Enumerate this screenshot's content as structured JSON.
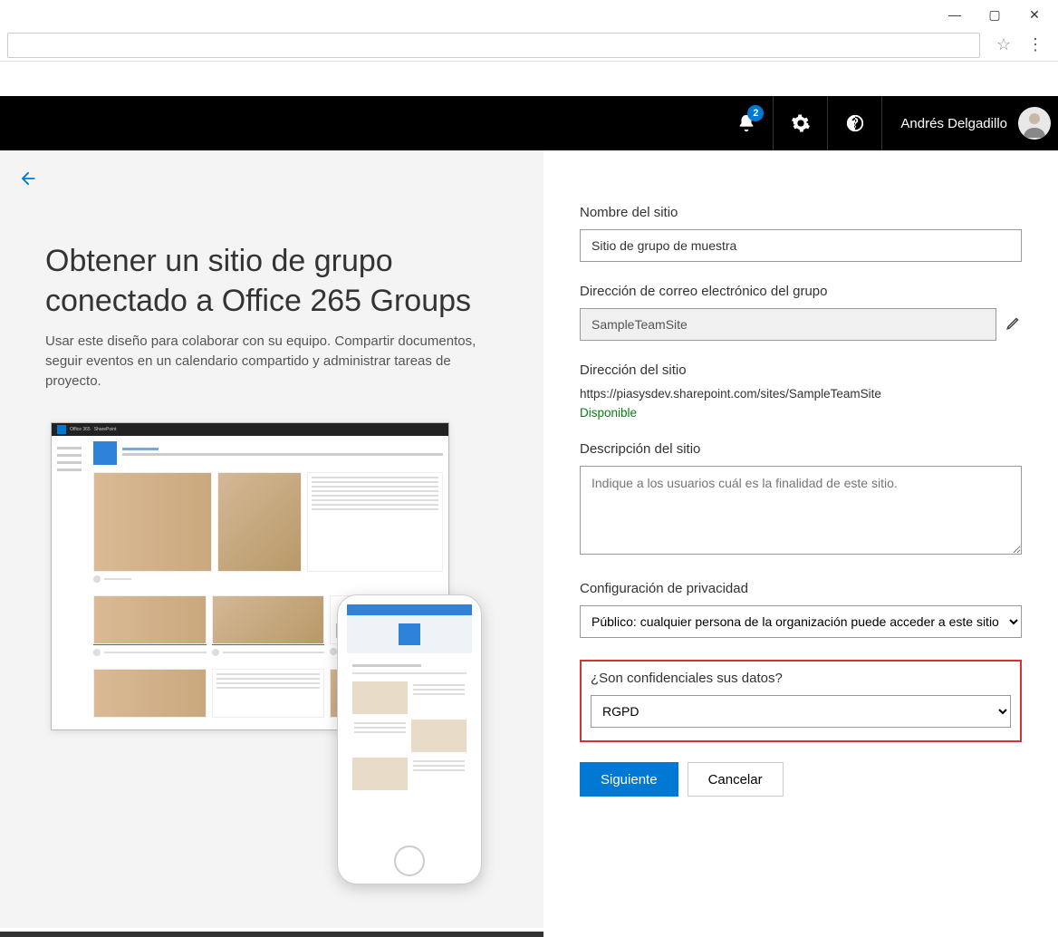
{
  "window": {
    "minimize": "—",
    "maximize": "▢",
    "close": "✕"
  },
  "header": {
    "notifications": "2",
    "user_name": "Andrés Delgadillo"
  },
  "left": {
    "title": "Obtener un sitio de grupo conectado a Office 265 Groups",
    "subtitle": "Usar este diseño para colaborar con su equipo. Compartir documentos, seguir eventos en un calendario compartido y administrar tareas de proyecto.",
    "preview_app1": "Office 365",
    "preview_app2": "SharePoint"
  },
  "form": {
    "site_name_label": "Nombre del sitio",
    "site_name_value": "Sitio de grupo de muestra",
    "email_label": "Dirección de correo electrónico del grupo",
    "email_value": "SampleTeamSite",
    "site_addr_label": "Dirección del sitio",
    "site_url": "https://piasysdev.sharepoint.com/sites/SampleTeamSite",
    "available": "Disponible",
    "desc_label": "Descripción del sitio",
    "desc_placeholder": "Indique a los usuarios cuál es la finalidad de este sitio.",
    "privacy_label": "Configuración de privacidad",
    "privacy_value": "Público: cualquier persona de la organización puede acceder a este sitio",
    "conf_label": "¿Son confidenciales sus datos?",
    "conf_value": "RGPD",
    "next": "Siguiente",
    "cancel": "Cancelar"
  }
}
